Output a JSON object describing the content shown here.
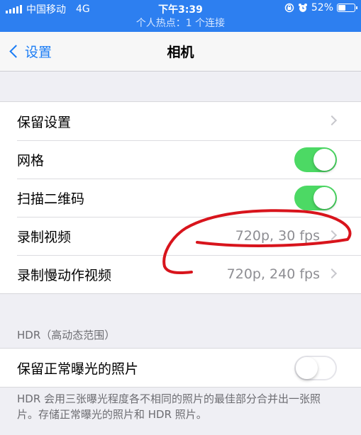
{
  "status_bar": {
    "carrier": "中国移动",
    "network": "4G",
    "time": "下午3:39",
    "battery": "52%",
    "battery_level": 0.52,
    "hotspot": "个人热点：1 个连接"
  },
  "nav": {
    "back_label": "设置",
    "title": "相机"
  },
  "settings": {
    "preserve_settings": "保留设置",
    "grid": {
      "label": "网格",
      "on": true
    },
    "scan_qr": {
      "label": "扫描二维码",
      "on": true
    },
    "record_video": {
      "label": "录制视频",
      "value": "720p, 30 fps"
    },
    "record_slomo": {
      "label": "录制慢动作视频",
      "value": "720p, 240 fps"
    }
  },
  "hdr": {
    "header": "HDR（高动态范围）",
    "keep_normal": {
      "label": "保留正常曝光的照片",
      "on": false
    },
    "footer": "HDR 会用三张曝光程度各不相同的照片的最佳部分合并出一张照片。存储正常曝光的照片和 HDR 照片。"
  },
  "colors": {
    "accent": "#1a7cf5",
    "status_bar": "#2d7ff0",
    "toggle_on": "#4cd964",
    "annotation": "#d8141c"
  },
  "icons": [
    "signal-icon",
    "rotation-lock-icon",
    "alarm-icon",
    "battery-icon",
    "back-chevron-icon",
    "chevron-right-icon"
  ]
}
